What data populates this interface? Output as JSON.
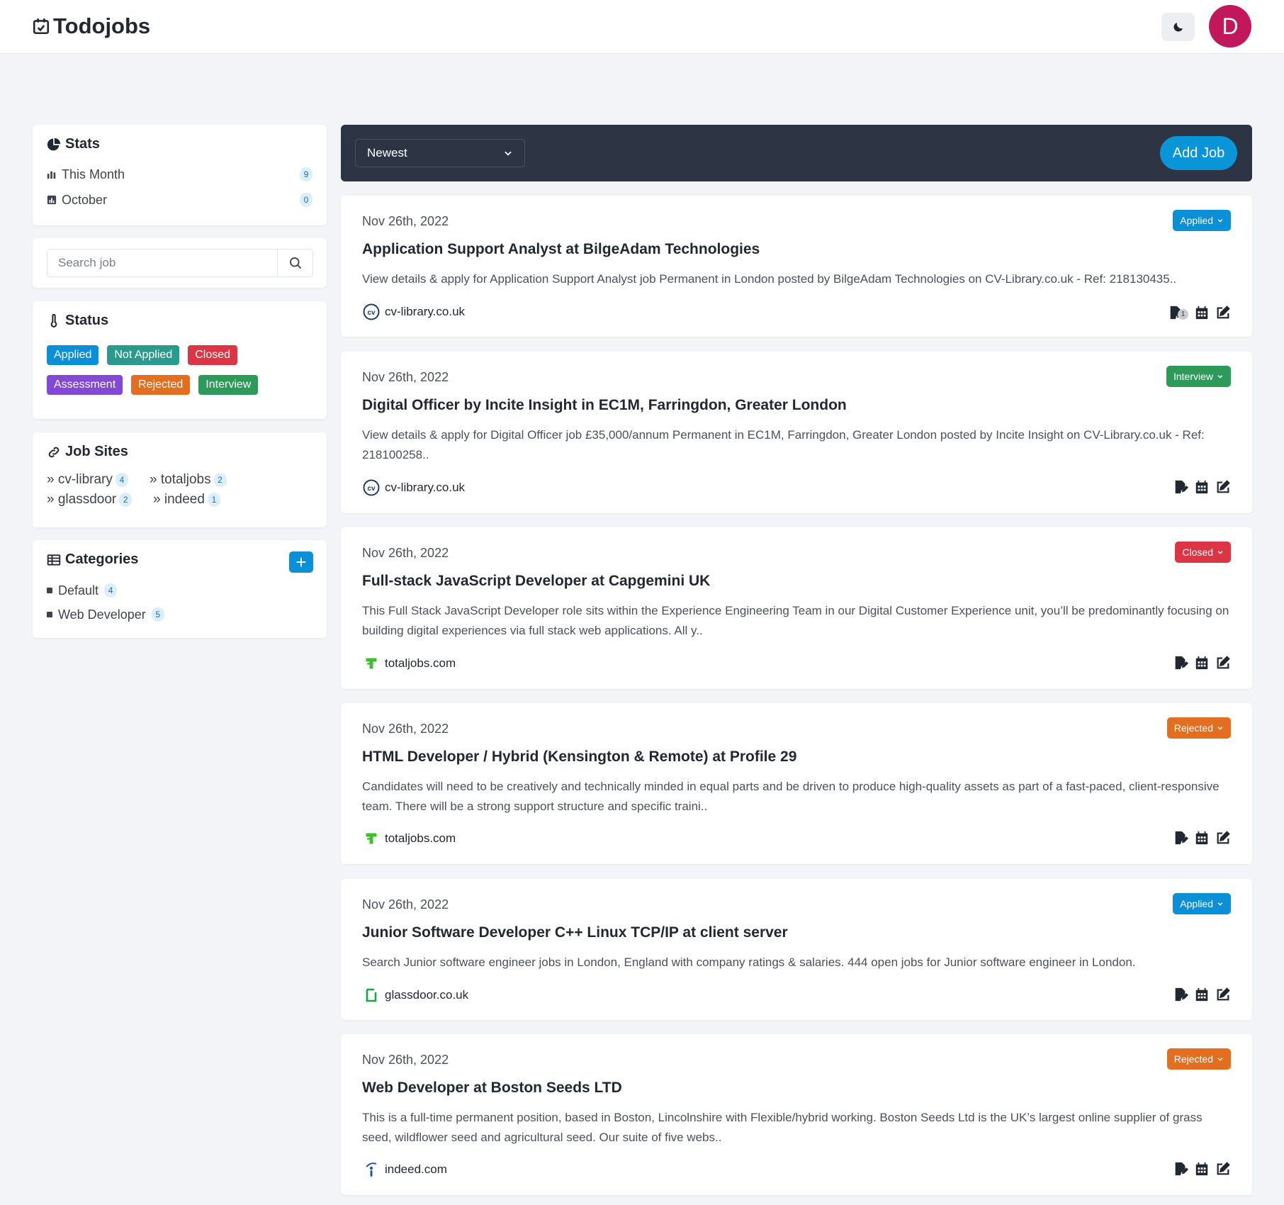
{
  "app": {
    "title": "Todojobs",
    "avatar_letter": "D"
  },
  "colors": {
    "applied": "#0b8fd6",
    "not_applied": "#2a9a8d",
    "closed": "#dc3545",
    "assessment": "#8248d6",
    "rejected": "#e36e1f",
    "interview": "#2e9a5a",
    "toolbar": "#2d3545",
    "avatar": "#c2185b"
  },
  "sidebar": {
    "stats": {
      "title": "Stats",
      "items": [
        {
          "label": "This Month",
          "count": "9"
        },
        {
          "label": "October",
          "count": "0"
        }
      ]
    },
    "search": {
      "placeholder": "Search job"
    },
    "status": {
      "title": "Status",
      "tags": [
        "Applied",
        "Not Applied",
        "Closed",
        "Assessment",
        "Rejected",
        "Interview"
      ]
    },
    "job_sites": {
      "title": "Job Sites",
      "items": [
        {
          "label": "» cv-library",
          "count": "4"
        },
        {
          "label": "» totaljobs",
          "count": "2"
        },
        {
          "label": "» glassdoor",
          "count": "2"
        },
        {
          "label": "» indeed",
          "count": "1"
        }
      ]
    },
    "categories": {
      "title": "Categories",
      "add_label": "+",
      "items": [
        {
          "label": "Default",
          "count": "4"
        },
        {
          "label": "Web Developer",
          "count": "5"
        }
      ]
    }
  },
  "toolbar": {
    "sort_value": "Newest",
    "add_job_label": "Add Job"
  },
  "jobs": [
    {
      "date": "Nov 26th, 2022",
      "title": "Application Support Analyst at BilgeAdam Technologies",
      "description": "View details & apply for Application Support Analyst job Permanent in London posted by BilgeAdam Technologies on CV-Library.co.uk - Ref: 218130435..",
      "status": "Applied",
      "site": "cv-library.co.uk",
      "site_icon": "cv-library-icon",
      "notes_count": "1"
    },
    {
      "date": "Nov 26th, 2022",
      "title": "Digital Officer by Incite Insight in EC1M, Farringdon, Greater London",
      "description": "View details & apply for Digital Officer job £35,000/annum Permanent in EC1M, Farringdon, Greater London posted by Incite Insight on CV-Library.co.uk - Ref: 218100258..",
      "status": "Interview",
      "site": "cv-library.co.uk",
      "site_icon": "cv-library-icon"
    },
    {
      "date": "Nov 26th, 2022",
      "title": "Full-stack JavaScript Developer at Capgemini UK",
      "description": "This Full Stack JavaScript Developer role sits within the Experience Engineering Team in our Digital Customer Experience unit, you’ll be predominantly focusing on building digital experiences via full stack web applications. All y..",
      "status": "Closed",
      "site": "totaljobs.com",
      "site_icon": "totaljobs-icon"
    },
    {
      "date": "Nov 26th, 2022",
      "title": "HTML Developer / Hybrid (Kensington & Remote) at Profile 29",
      "description": "Candidates will need to be creatively and technically minded in equal parts and be driven to produce high-quality assets as part of a fast-paced, client-responsive team. There will be a strong support structure and specific traini..",
      "status": "Rejected",
      "site": "totaljobs.com",
      "site_icon": "totaljobs-icon"
    },
    {
      "date": "Nov 26th, 2022",
      "title": "Junior Software Developer C++ Linux TCP/IP at client server",
      "description": "Search Junior software engineer jobs in London, England with company ratings & salaries. 444 open jobs for Junior software engineer in London.",
      "status": "Applied",
      "site": "glassdoor.co.uk",
      "site_icon": "glassdoor-icon"
    },
    {
      "date": "Nov 26th, 2022",
      "title": "Web Developer at Boston Seeds LTD",
      "description": "This is a full-time permanent position, based in Boston, Lincolnshire with Flexible/hybrid working. Boston Seeds Ltd is the UK’s largest online supplier of grass seed, wildflower seed and agricultural seed. Our suite of five webs..",
      "status": "Rejected",
      "site": "indeed.com",
      "site_icon": "indeed-icon"
    }
  ]
}
